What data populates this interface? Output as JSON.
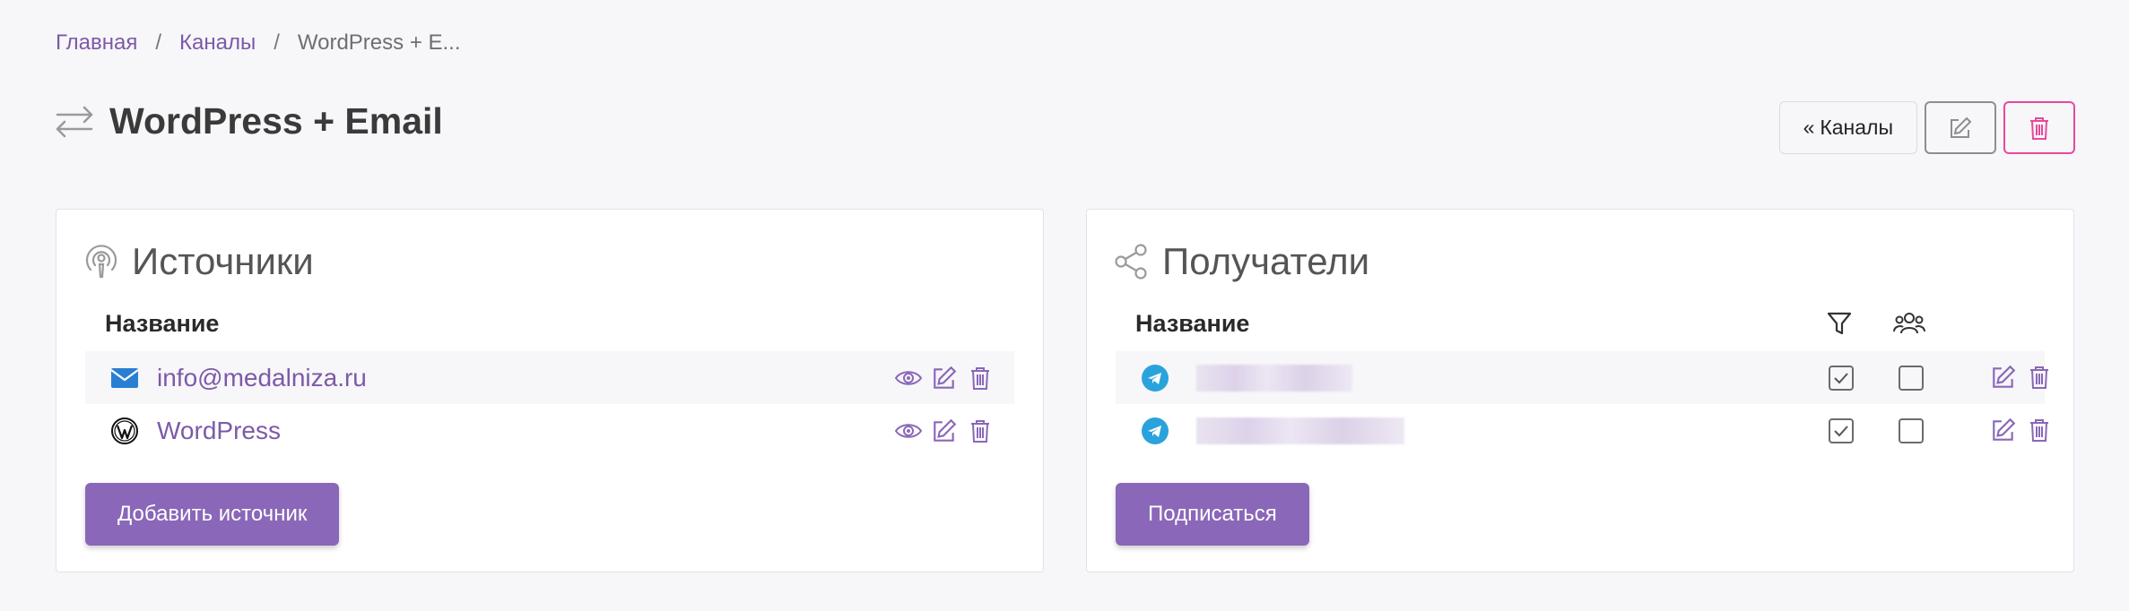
{
  "breadcrumb": {
    "home": "Главная",
    "channels": "Каналы",
    "current": "WordPress + E...",
    "separator": "/"
  },
  "page": {
    "title": "WordPress + Email"
  },
  "actions": {
    "channels_label": "Каналы",
    "channels_prefix": "«"
  },
  "sources": {
    "title": "Источники",
    "column_name": "Название",
    "rows": [
      {
        "label": "info@medalniza.ru",
        "icon": "mail-icon"
      },
      {
        "label": "WordPress",
        "icon": "wordpress-icon"
      }
    ],
    "add_button": "Добавить источник"
  },
  "recipients": {
    "title": "Получатели",
    "column_name": "Название",
    "column_icons": [
      "filter-icon",
      "users-icon"
    ],
    "rows": [
      {
        "icon": "telegram-icon",
        "filter_checked": true,
        "group_checked": false
      },
      {
        "icon": "telegram-icon",
        "filter_checked": true,
        "group_checked": false
      }
    ],
    "subscribe_button": "Подписаться"
  },
  "colors": {
    "accent": "#8a67b8",
    "link": "#7c5aa8",
    "danger": "#e8489d",
    "telegram": "#2aa3dd",
    "mail": "#2a7fd4"
  }
}
